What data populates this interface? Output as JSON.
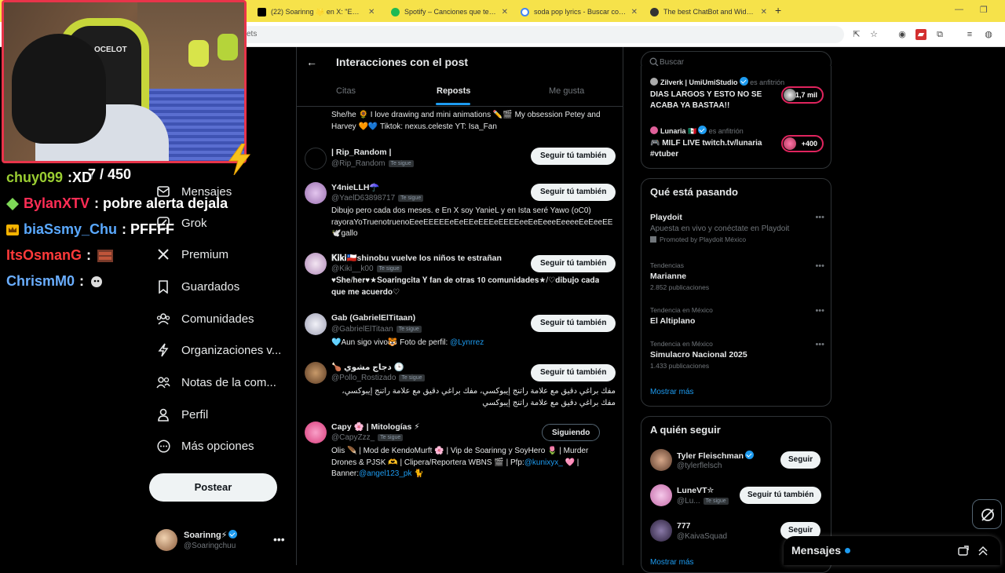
{
  "browser": {
    "tabs": [
      {
        "title": "(22) Soarinng 🌟 en X: \"EN STR",
        "favicon": "x-favicon",
        "color": "#000000"
      },
      {
        "title": "Spotify – Canciones que te gust",
        "favicon": "spotify-favicon",
        "color": "#1db954"
      },
      {
        "title": "soda pop lyrics - Buscar con Go",
        "favicon": "google-favicon",
        "color": "#4285f4"
      },
      {
        "title": "The best ChatBot and Widgets",
        "favicon": "chatbot-favicon",
        "color": "#333333"
      }
    ],
    "address_partial": "ets"
  },
  "stream_chat": [
    {
      "user": "chuy099",
      "message": ":XD",
      "user_color": "#9acd32",
      "badge": ""
    },
    {
      "user": "BylanXTV",
      "message": ": pobre alerta dejala",
      "user_color": "#ff2d55",
      "badge": "diamond-badge"
    },
    {
      "user": "biaSsmy_Chu",
      "message": ": PFFFF",
      "user_color": "#5aa9ff",
      "badge": "crown-badge"
    },
    {
      "user": "ItsOsmanG",
      "message": ":",
      "user_color": "#ff3a3a",
      "badge": ""
    },
    {
      "user": "ChrismM0",
      "message": ":",
      "user_color": "#6aaeff",
      "badge": ""
    }
  ],
  "stream_overlay": {
    "counter": "7 / 450"
  },
  "nav": {
    "items": [
      {
        "label": "Mensajes",
        "icon": "mail-icon"
      },
      {
        "label": "Grok",
        "icon": "grok-icon"
      },
      {
        "label": "Premium",
        "icon": "x-logo-icon"
      },
      {
        "label": "Guardados",
        "icon": "bookmark-icon"
      },
      {
        "label": "Comunidades",
        "icon": "communities-icon"
      },
      {
        "label": "Organizaciones v...",
        "icon": "lightning-icon"
      },
      {
        "label": "Notas de la com...",
        "icon": "community-notes-icon"
      },
      {
        "label": "Perfil",
        "icon": "person-icon"
      },
      {
        "label": "Más opciones",
        "icon": "more-circle-icon"
      }
    ],
    "post_label": "Postear",
    "profile": {
      "name": "Soarinng⚡",
      "handle": "@Soaringchuu"
    }
  },
  "center": {
    "title": "Interacciones con el post",
    "tabs": [
      {
        "label": "Citas"
      },
      {
        "label": "Reposts"
      },
      {
        "label": "Me gusta"
      }
    ],
    "follows_you_label": "Te sigue",
    "users": [
      {
        "name": "",
        "handle": "",
        "bio": "She/he 🌻 I love drawing and mini animations ✏️🎬 My obsession Petey and Harvey 🧡💙 Tiktok: nexus.celeste YT: Isa_Fan",
        "button": "",
        "avatar_color": "#6b6b6b"
      },
      {
        "name": "| Rip_Random |",
        "handle": "@Rip_Random",
        "bio": "",
        "button": "Seguir tú también",
        "avatar_color": "#000000"
      },
      {
        "name": "Y4nieLLH☂️",
        "handle": "@YaelD63898717",
        "bio": "Dibujo pero cada dos meses. e En X soy YanieL y en Ista seré Yawo (oC0) rayoraYoTruenotruenoEeeEEEEEeEeEEeEEEeEEEEeeEeEeeeEeeeeEeEeeEE 🕊️gallo",
        "button": "Seguir tú también",
        "avatar_color": "#c9a3d6"
      },
      {
        "name": "𝐊𝐢𝐤𝐢🇨🇱shinobu vuelve los niños te estrañan",
        "handle": "@Kiki__k00",
        "bio": "♥𝐒𝐡𝐞/𝐡𝐞𝐫♥★𝐒𝐨𝐚𝐫𝐢𝐧𝐠𝐜𝐢𝐭𝐚 𝐘 𝐟𝐚𝐧 𝐝𝐞 𝐨𝐭𝐫𝐚𝐬 𝟏𝟎 𝐜𝐨𝐦𝐮𝐧𝐢𝐝𝐚𝐝𝐞𝐬★/♡𝐝𝐢𝐛𝐮𝐣𝐨 𝐜𝐚𝐝𝐚 𝐪𝐮𝐞 𝐦𝐞 𝐚𝐜𝐮𝐞𝐫𝐝𝐨♡",
        "button": "Seguir tú también",
        "avatar_color": "#e6d2e8"
      },
      {
        "name": "Gab (GabrielElTitaan)",
        "handle": "@GabrielElTitaan",
        "bio": "🩵Aun sigo vivo🐯 Foto de perfil: ",
        "bio_link": "@Lynrrez",
        "button": "Seguir tú también",
        "avatar_color": "#d9d9e6"
      },
      {
        "name": "🍗 دجاج مشوي 🕒",
        "handle": "@Pollo_Rostizado",
        "bio": "مفك براغي دقيق مع علامة راتنج إيبوكسي، مفك براغي دقيق مع علامة راتنج إيبوكسي، مفك براغي دقيق مع علامة راتنج إيبوكسي",
        "button": "Seguir tú también",
        "avatar_color": "#8b6a4a"
      },
      {
        "name": "Capy 🌸 | Mitologías ⚡",
        "handle": "@CapyZzz_",
        "bio": "Olis 🪶 | Mod de KendoMurft 🌸 | Vip de Soarinng y SoyHero 🌷 | Murder Drones & PJSK 🫶 | Clipera/Reportera WBNS 🎬 | Pfp:",
        "bio_link": "@kunixyx_",
        "bio_tail": " 🩷 | Banner:",
        "bio_link2": "@angel123_pk",
        "bio_end": " 🐈",
        "button": "Siguiendo",
        "avatar_color": "#e84a8a"
      }
    ]
  },
  "right": {
    "search_placeholder": "Buscar",
    "spaces": [
      {
        "host": "Zilverk | UmiUmiStudio",
        "host_suffix": "es anfitrión",
        "title": "DIAS LARGOS Y ESTO NO SE ACABA YA BASTAA!!",
        "listeners": "+1,7 mil"
      },
      {
        "host": "Lunaria 🇲🇽",
        "host_suffix": "es anfitrión",
        "title": "🎮 MILF LIVE twitch.tv/lunaria #vtuber",
        "listeners": "+400"
      }
    ],
    "trends_title": "Qué está pasando",
    "trends": [
      {
        "context": "",
        "name": "Playdoit",
        "desc": "Apuesta en vivo y conéctate en Playdoit",
        "count": "Promoted by Playdoit México"
      },
      {
        "context": "Tendencias",
        "name": "Marianne",
        "count": "2.852 publicaciones"
      },
      {
        "context": "Tendencia en México",
        "name": "El Altiplano",
        "count": ""
      },
      {
        "context": "Tendencia en México",
        "name": "Simulacro Nacional 2025",
        "count": "1.433 publicaciones"
      }
    ],
    "show_more": "Mostrar más",
    "who_to_follow_title": "A quién seguir",
    "who_to_follow": [
      {
        "name": "Tyler Fleischman",
        "handle": "@tylerflelsch",
        "button": "Seguir",
        "verified": true,
        "avatar_color": "#7a5a48"
      },
      {
        "name": "LuneVT✮",
        "handle": "@Lu...",
        "button": "Seguir tú también",
        "follows_you": true,
        "avatar_color": "#e7a6d8"
      },
      {
        "name": "777",
        "handle": "@KaivaSquad",
        "button": "Seguir",
        "avatar_color": "#4a3a5a"
      }
    ],
    "show_more_2": "Mostrar más"
  },
  "messages_drawer": {
    "title": "Mensajes"
  }
}
